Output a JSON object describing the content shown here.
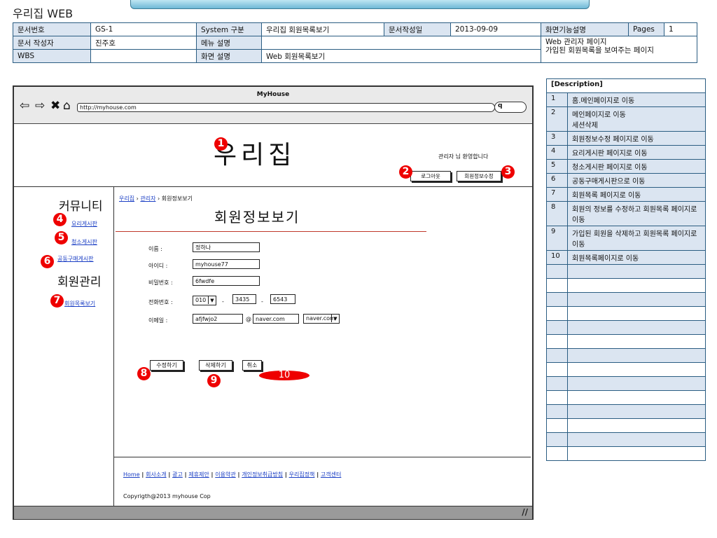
{
  "app_title": "우리집 WEB",
  "info": {
    "doc_no_label": "문서번호",
    "doc_no": "GS-1",
    "system_label": "System 구분",
    "system": "우리집 회원목록보기",
    "date_label": "문서작성일",
    "date": "2013-09-09",
    "screen_func_label": "화면기능설명",
    "pages_label": "Pages",
    "pages": "1",
    "author_label": "문서 작성자",
    "author": "진주호",
    "menu_label": "메뉴 설명",
    "menu": "",
    "wbs_label": "WBS",
    "wbs": "",
    "screen_desc_label": "화면 설명",
    "screen_desc": "Web 회원목록보기",
    "func_desc_line1": "Web 관리자 페이지",
    "func_desc_line2": "가입된 회원목록을 보여주는 페이지"
  },
  "browser": {
    "title": "MyHouse",
    "url": "http://myhouse.com",
    "search_glyph": "q"
  },
  "site": {
    "logo": "우리집",
    "welcome": "관리자 님 환영합니다",
    "logout": "로그아웃",
    "edit_info": "회원정보수정",
    "sidebar": {
      "community": "커뮤니티",
      "cooking": "요리게시판",
      "cleaning": "청소게시판",
      "groupbuy": "공동구매게시판",
      "member_mgmt": "회원관리",
      "member_list": "회원목록보기"
    },
    "breadcrumb": {
      "home": "우리집",
      "admin": "관리자",
      "current": "회원정보보기",
      "sep": "›"
    },
    "page_title": "회원정보보기",
    "form": {
      "name_label": "이름 :",
      "name": "정하나",
      "id_label": "아이디 :",
      "id": "myhouse77",
      "pw_label": "비밀번호 :",
      "pw": "6fwdfe",
      "phone_label": "전화번호 :",
      "phone1": "010",
      "phone2": "3435",
      "phone3": "6543",
      "dash": "-",
      "email_label": "이메일 :",
      "email_id": "afjfwjo2",
      "at": "@",
      "email_domain": "naver.com",
      "email_select": "naver.com"
    },
    "buttons": {
      "edit": "수정하기",
      "delete": "삭제하기",
      "cancel": "취소"
    },
    "footer": {
      "links": [
        "Home",
        "회사소개",
        "광고",
        "제휴제안",
        "이용약관",
        "개인정보취급방침",
        "우리집정책",
        "고객센터"
      ],
      "copyright": "Copyrigth@2013 myhouse Cop"
    }
  },
  "markers": [
    "1",
    "2",
    "3",
    "4",
    "5",
    "6",
    "7",
    "8",
    "9",
    "10"
  ],
  "description": {
    "header": "[Description]",
    "rows": [
      {
        "n": "1",
        "text": "홈.메인페이지로 이동"
      },
      {
        "n": "2",
        "text": "메인페이지로 이동\n세션삭제"
      },
      {
        "n": "3",
        "text": "회원정보수정 페이지로 이동"
      },
      {
        "n": "4",
        "text": "요리게시판 페이지로 이동"
      },
      {
        "n": "5",
        "text": "청소게시판 페이지로 이동"
      },
      {
        "n": "6",
        "text": "공동구매게시판으로 이동"
      },
      {
        "n": "7",
        "text": "회원목록 페이지로 이동"
      },
      {
        "n": "8",
        "text": "회원의 정보를 수정하고 회원목록 페이지로 이동"
      },
      {
        "n": "9",
        "text": "가입된 회원을 삭제하고 회원목록 페이지로 이동"
      },
      {
        "n": "10",
        "text": "회원목록페이지로 이동"
      }
    ]
  },
  "colors": {
    "header_cell": "#dbe5f1",
    "border": "#2b5d82",
    "marker": "#ee0000",
    "link": "#1a3ec4"
  }
}
